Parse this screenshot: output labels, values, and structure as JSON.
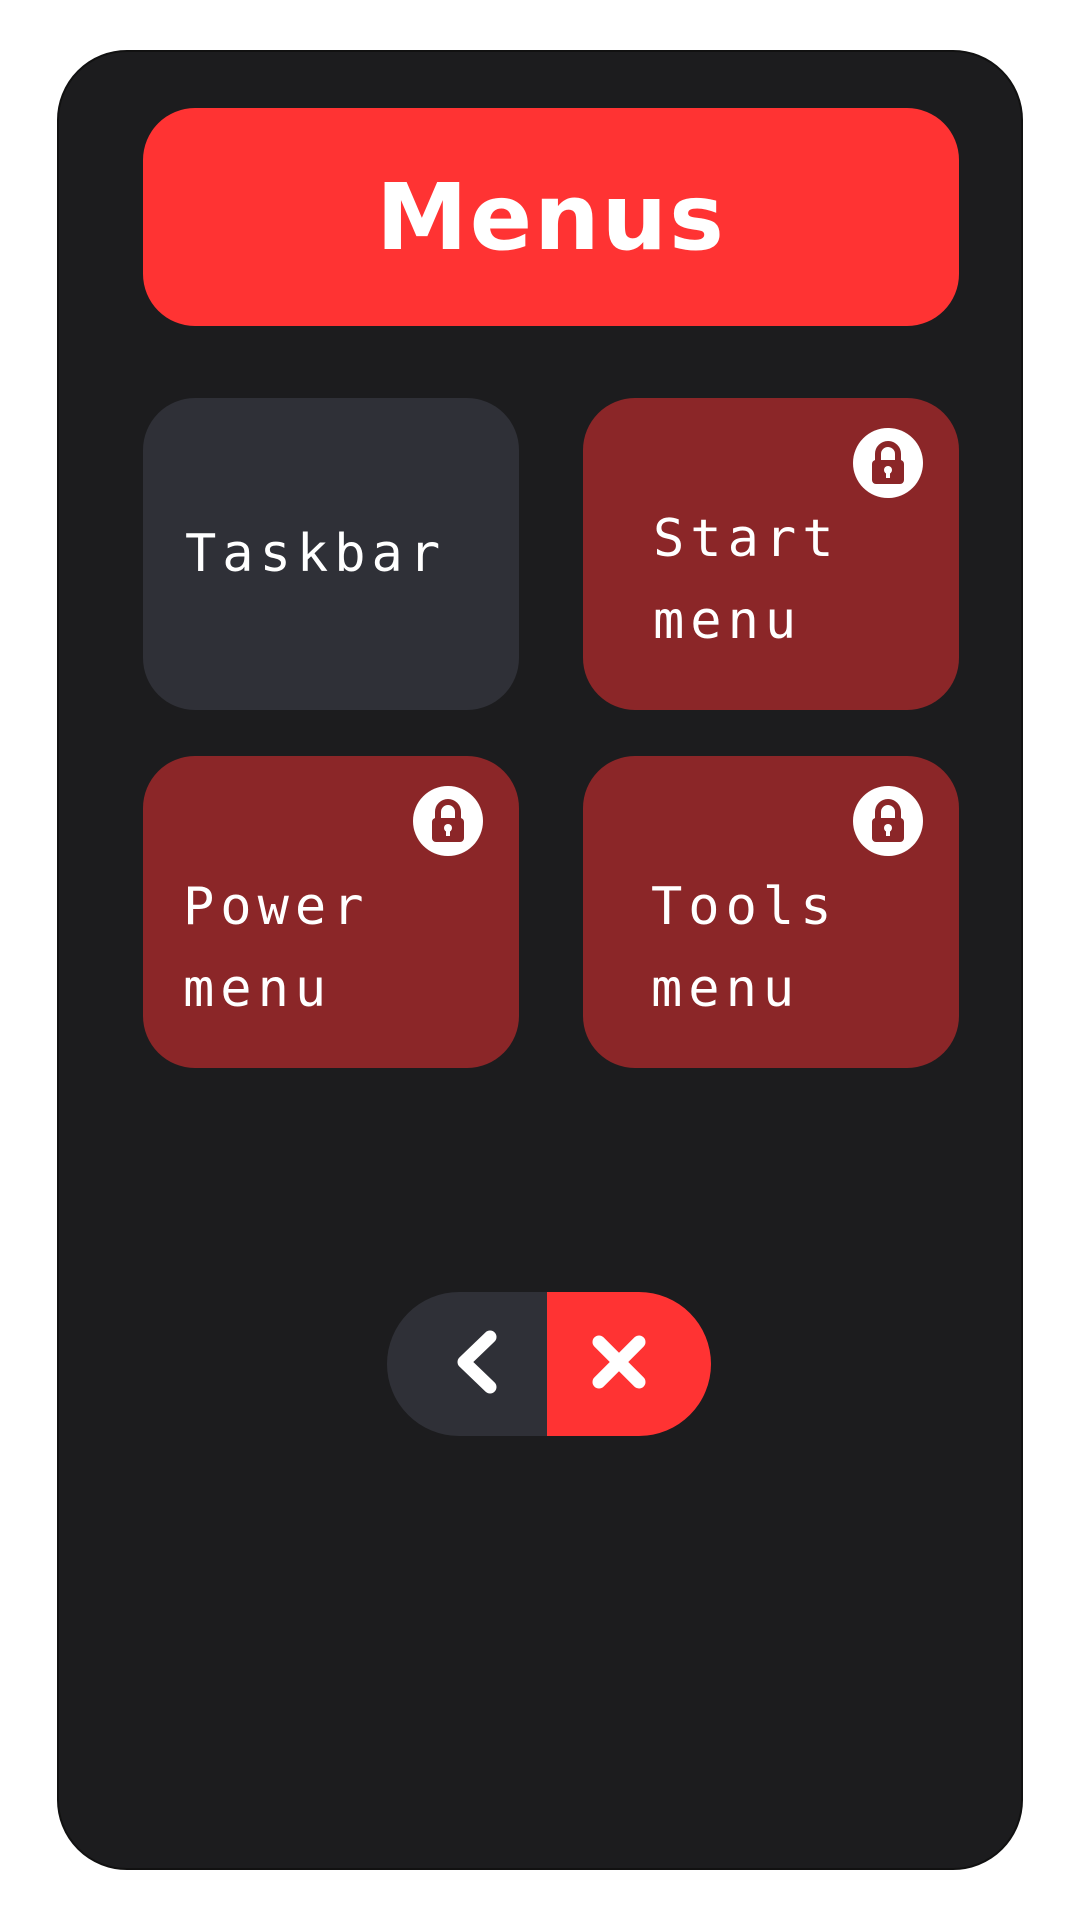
{
  "header": {
    "title": "Menus"
  },
  "tiles": [
    {
      "label": "Taskbar",
      "locked": false
    },
    {
      "label": "Start\nmenu",
      "locked": true
    },
    {
      "label": "Power\n menu",
      "locked": true
    },
    {
      "label": "Tools\nmenu",
      "locked": true
    }
  ],
  "icons": {
    "lock": "lock-icon",
    "back": "chevron-left-icon",
    "close": "close-icon"
  },
  "colors": {
    "accent": "#ff3333",
    "locked_tile": "#8b2628",
    "unlocked_tile": "#2f3037",
    "background": "#1c1c1e"
  }
}
